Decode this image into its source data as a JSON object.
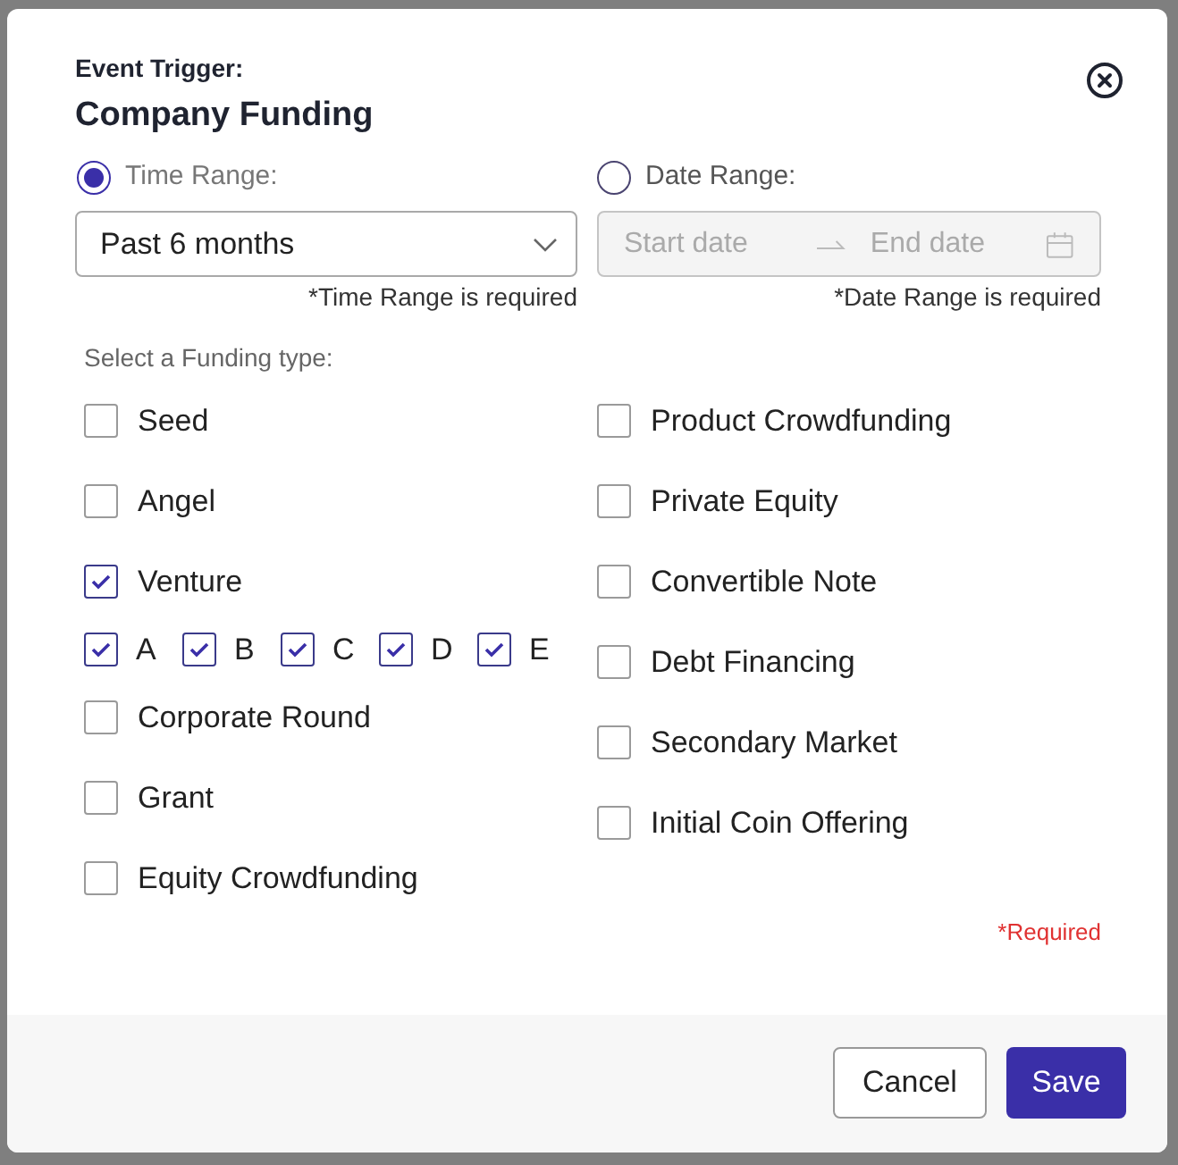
{
  "dialog": {
    "eyebrow": "Event Trigger:",
    "title": "Company Funding"
  },
  "time_range": {
    "label": "Time Range:",
    "selected": true,
    "value": "Past 6 months",
    "hint": "*Time Range is required"
  },
  "date_range": {
    "label": "Date Range:",
    "selected": false,
    "disabled": true,
    "start_placeholder": "Start date",
    "end_placeholder": "End date",
    "hint": "*Date Range is required"
  },
  "funding_types": {
    "label": "Select a Funding type:",
    "left": [
      {
        "label": "Seed",
        "checked": false
      },
      {
        "label": "Angel",
        "checked": false
      },
      {
        "label": "Venture",
        "checked": true,
        "children": [
          {
            "label": "A",
            "checked": true
          },
          {
            "label": "B",
            "checked": true
          },
          {
            "label": "C",
            "checked": true
          },
          {
            "label": "D",
            "checked": true
          },
          {
            "label": "E",
            "checked": true
          }
        ]
      },
      {
        "label": "Corporate Round",
        "checked": false
      },
      {
        "label": "Grant",
        "checked": false
      },
      {
        "label": "Equity Crowdfunding",
        "checked": false
      }
    ],
    "right": [
      {
        "label": "Product Crowdfunding",
        "checked": false
      },
      {
        "label": "Private Equity",
        "checked": false
      },
      {
        "label": "Convertible Note",
        "checked": false
      },
      {
        "label": "Debt Financing",
        "checked": false
      },
      {
        "label": "Secondary Market",
        "checked": false
      },
      {
        "label": "Initial Coin Offering",
        "checked": false
      }
    ]
  },
  "required_note": "*Required",
  "buttons": {
    "cancel": "Cancel",
    "save": "Save"
  }
}
